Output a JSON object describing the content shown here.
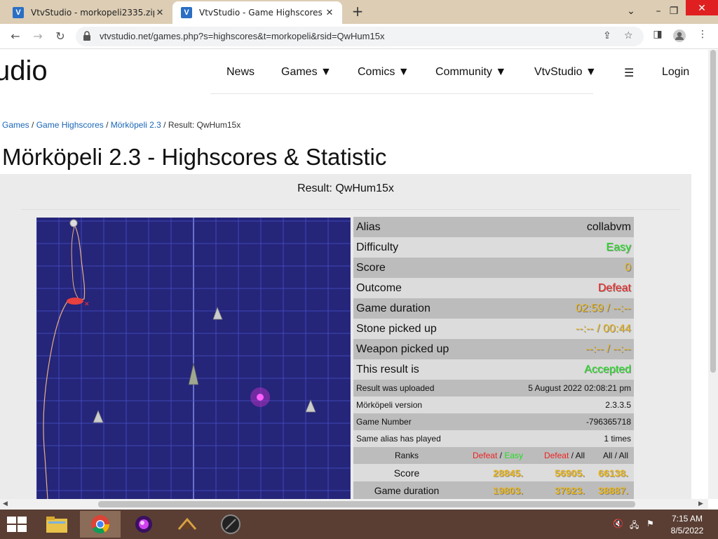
{
  "browser": {
    "tabs": [
      {
        "title": "VtvStudio - morkopeli2335.zip",
        "favicon": "V"
      },
      {
        "title": "VtvStudio - Game Highscores",
        "favicon": "V"
      }
    ],
    "url": "vtvstudio.net/games.php?s=highscores&t=morkopeli&rsid=QwHum15x"
  },
  "site": {
    "logo": "udio",
    "nav": [
      "News",
      "Games ▼",
      "Comics ▼",
      "Community ▼",
      "VtvStudio ▼",
      "☰",
      "Login"
    ]
  },
  "breadcrumb": {
    "games": "Games",
    "highscores": "Game Highscores",
    "game": "Mörköpeli 2.3",
    "current": "Result: QwHum15x",
    "sep": " / "
  },
  "page_title": "Mörköpeli 2.3 - Highscores & Statistic",
  "result_heading": "Result: QwHum15x",
  "stats": {
    "alias": {
      "label": "Alias",
      "value": "collabvm"
    },
    "difficulty": {
      "label": "Difficulty",
      "value": "Easy"
    },
    "score": {
      "label": "Score",
      "value": "0"
    },
    "outcome": {
      "label": "Outcome",
      "value": "Defeat"
    },
    "duration": {
      "label": "Game duration",
      "value": "02:59 / --:--"
    },
    "stone": {
      "label": "Stone picked up",
      "value": "--:-- / 00:44"
    },
    "weapon": {
      "label": "Weapon picked up",
      "value": "--:-- / --:--"
    },
    "result": {
      "label": "This result is",
      "value": "Accepted"
    },
    "uploaded": {
      "label": "Result was uploaded",
      "value": "5 August 2022 02:08:21 pm"
    },
    "version": {
      "label": "Mörköpeli version",
      "value": "2.3.3.5"
    },
    "game_number": {
      "label": "Game Number",
      "value": "-796365718"
    },
    "same_alias": {
      "label": "Same alias has played",
      "value": "1 times"
    }
  },
  "ranks": {
    "header": {
      "label": "Ranks",
      "c1a": "Defeat",
      "c1b": "Easy",
      "c2a": "Defeat",
      "c2b": "All",
      "c3a": "All",
      "c3b": "All",
      "slash": " / "
    },
    "rows": [
      {
        "label": "Score",
        "v1": "28845.",
        "v2": "56905.",
        "v3": "66138."
      },
      {
        "label": "Game duration",
        "v1": "19803.",
        "v2": "37923.",
        "v3": "38887."
      }
    ]
  },
  "taskbar": {
    "time": "7:15 AM",
    "date": "8/5/2022"
  },
  "icons": [
    "search-icon",
    "lock-icon",
    "share-icon",
    "star-icon",
    "sidebar-icon",
    "profile-icon",
    "menu-icon"
  ]
}
